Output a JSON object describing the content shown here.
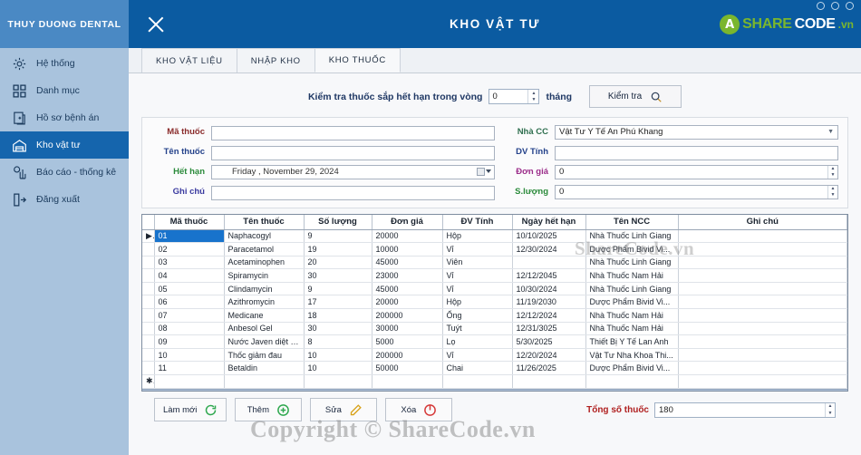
{
  "sidebar": {
    "brand": "THUY DUONG DENTAL",
    "items": [
      {
        "label": "Hệ thống",
        "icon": "gear-icon",
        "active": false
      },
      {
        "label": "Danh mục",
        "icon": "grid-icon",
        "active": false
      },
      {
        "label": "Hồ sơ bệnh án",
        "icon": "medical-record-icon",
        "active": false
      },
      {
        "label": "Kho vật tư",
        "icon": "warehouse-icon",
        "active": true
      },
      {
        "label": "Báo cáo - thống kê",
        "icon": "chart-report-icon",
        "active": false
      },
      {
        "label": "Đăng xuất",
        "icon": "logout-icon",
        "active": false
      }
    ]
  },
  "titlebar": {
    "title": "KHO VẬT TƯ",
    "close_icon": "close-icon",
    "logo": {
      "mark": "A",
      "part1": "SHARE",
      "part2": "CODE",
      "part3": ".vn"
    }
  },
  "tabs": [
    {
      "label": "KHO VẬT LIỆU",
      "active": false
    },
    {
      "label": "NHẬP KHO",
      "active": false
    },
    {
      "label": "KHO THUỐC",
      "active": true
    }
  ],
  "expiry_check": {
    "label": "Kiểm tra thuốc sắp hết hạn trong vòng",
    "months_value": "0",
    "unit": "tháng",
    "button": "Kiểm tra",
    "button_icon": "search-icon"
  },
  "form": {
    "left": [
      {
        "label": "Mã thuốc",
        "color": "#8a2b2b",
        "type": "text",
        "value": ""
      },
      {
        "label": "Tên thuốc",
        "color": "#23418a",
        "type": "text",
        "value": ""
      },
      {
        "label": "Hết hạn",
        "color": "#2a8a3a",
        "type": "date",
        "value": "Friday    , November 29, 2024"
      },
      {
        "label": "Ghi chú",
        "color": "#3b3ba0",
        "type": "text",
        "value": ""
      }
    ],
    "right": [
      {
        "label": "Nhà CC",
        "color": "#2f6f4f",
        "type": "combo",
        "value": "Vật Tư Y Tế An Phú Khang"
      },
      {
        "label": "DV Tính",
        "color": "#23418a",
        "type": "text",
        "value": ""
      },
      {
        "label": "Đơn giá",
        "color": "#9b2d8a",
        "type": "number",
        "value": "0"
      },
      {
        "label": "S.lượng",
        "color": "#2a8a3a",
        "type": "number",
        "value": "0"
      }
    ]
  },
  "grid": {
    "columns": [
      "Mã thuốc",
      "Tên thuốc",
      "Số lượng",
      "Đơn giá",
      "ĐV Tính",
      "Ngày hết hạn",
      "Tên NCC",
      "Ghi chú"
    ],
    "rows": [
      {
        "selected": true,
        "cells": [
          "01",
          "Naphacogyl",
          "9",
          "20000",
          "Hộp",
          "10/10/2025",
          "Nhà Thuốc Linh Giang",
          ""
        ]
      },
      {
        "selected": false,
        "cells": [
          "02",
          "Paracetamol",
          "19",
          "10000",
          "Vỉ",
          "12/30/2024",
          "Dược Phẩm Bivid Vi...",
          ""
        ]
      },
      {
        "selected": false,
        "cells": [
          "03",
          "Acetaminophen",
          "20",
          "45000",
          "Viên",
          "",
          "Nhà Thuốc Linh Giang",
          ""
        ]
      },
      {
        "selected": false,
        "cells": [
          "04",
          "Spiramycin",
          "30",
          "23000",
          "Vỉ",
          "12/12/2045",
          "Nhà Thuốc Nam Hải",
          ""
        ]
      },
      {
        "selected": false,
        "cells": [
          "05",
          "Clindamycin",
          "9",
          "45000",
          "Vỉ",
          "10/30/2024",
          "Nhà Thuốc Linh Giang",
          ""
        ]
      },
      {
        "selected": false,
        "cells": [
          "06",
          "Azithromycin",
          "17",
          "20000",
          "Hộp",
          "11/19/2030",
          "Dược Phẩm Bivid Vi...",
          ""
        ]
      },
      {
        "selected": false,
        "cells": [
          "07",
          "Medicane",
          "18",
          "200000",
          "Ống",
          "12/12/2024",
          "Nhà Thuốc Nam Hải",
          ""
        ]
      },
      {
        "selected": false,
        "cells": [
          "08",
          "Anbesol Gel",
          "30",
          "30000",
          "Tuýt",
          "12/31/3025",
          "Nhà Thuốc Nam Hải",
          ""
        ]
      },
      {
        "selected": false,
        "cells": [
          "09",
          "Nước Javen diệt tuỷ",
          "8",
          "5000",
          "Lọ",
          "5/30/2025",
          "Thiết Bị Y Tế Lan Anh",
          ""
        ]
      },
      {
        "selected": false,
        "cells": [
          "10",
          "Thốc giảm đau",
          "10",
          "200000",
          "Vỉ",
          "12/20/2024",
          "Vật Tư Nha Khoa Thi...",
          ""
        ]
      },
      {
        "selected": false,
        "cells": [
          "11",
          "Betaldin",
          "10",
          "50000",
          "Chai",
          "11/26/2025",
          "Dược Phẩm Bivid Vi...",
          ""
        ]
      },
      {
        "selected": false,
        "cells": [
          "",
          "",
          "",
          "",
          "",
          "",
          "",
          ""
        ]
      }
    ]
  },
  "bottom": {
    "buttons": [
      {
        "label": "Làm mới",
        "icon": "refresh-icon",
        "color": "#2fa84f"
      },
      {
        "label": "Thêm",
        "icon": "add-icon",
        "color": "#2fa84f"
      },
      {
        "label": "Sửa",
        "icon": "edit-icon",
        "color": "#d8a21a"
      },
      {
        "label": "Xóa",
        "icon": "delete-icon",
        "color": "#d63b3b"
      }
    ],
    "total_label": "Tổng số thuốc",
    "total_value": "180"
  },
  "watermarks": {
    "grid": "ShareCode.vn",
    "copyright": "Copyright © ShareCode.vn"
  }
}
